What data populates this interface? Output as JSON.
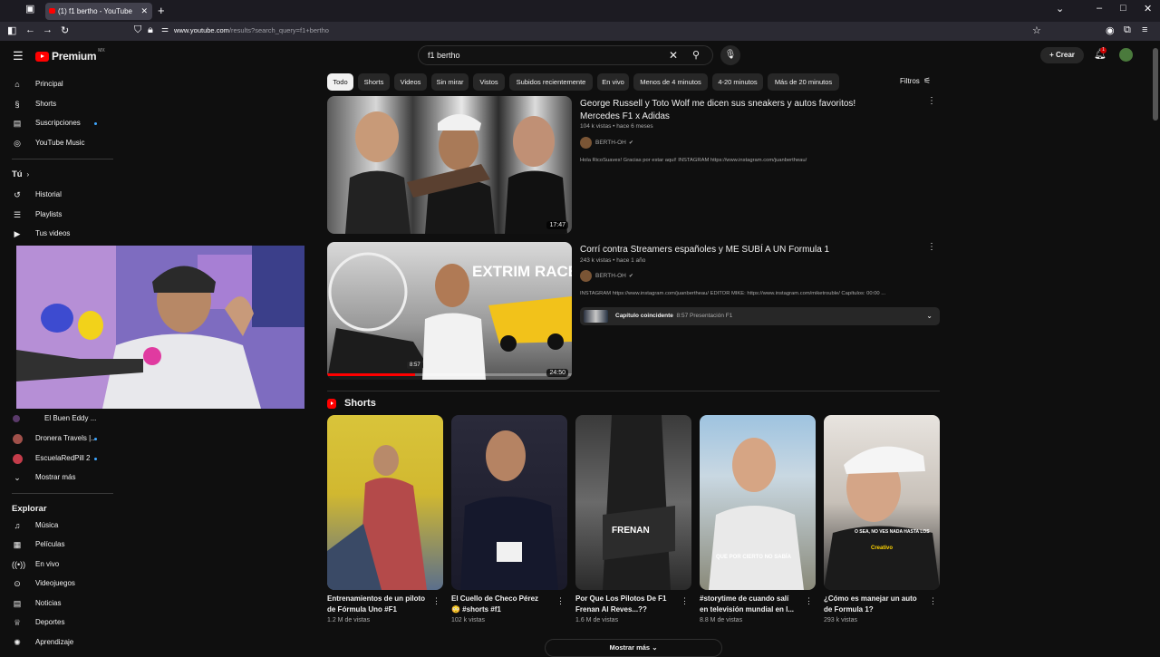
{
  "browser": {
    "tab_title": "(1) f1 bertho - YouTube",
    "url_domain": "www.youtube.com",
    "url_path": "/results?search_query=f1+bertho"
  },
  "header": {
    "logo_text": "Premium",
    "logo_region": "MX",
    "search_query": "f1 bertho",
    "create_label": "Crear",
    "notification_count": "1"
  },
  "sidebar": {
    "main": [
      {
        "label": "Principal",
        "icon": "home-icon"
      },
      {
        "label": "Shorts",
        "icon": "shorts-icon"
      },
      {
        "label": "Suscripciones",
        "icon": "subscriptions-icon"
      },
      {
        "label": "YouTube Music",
        "icon": "music-icon"
      }
    ],
    "you_heading": "Tú",
    "you": [
      {
        "label": "Historial"
      },
      {
        "label": "Playlists"
      },
      {
        "label": "Tus videos"
      }
    ],
    "subs": [
      {
        "label": "El Buen Eddy ..."
      },
      {
        "label": "Dronera Travels |..."
      },
      {
        "label": "EscuelaRedPill 2"
      }
    ],
    "show_more": "Mostrar más",
    "explore_heading": "Explorar",
    "explore": [
      {
        "label": "Música"
      },
      {
        "label": "Películas"
      },
      {
        "label": "En vivo"
      },
      {
        "label": "Videojuegos"
      },
      {
        "label": "Noticias"
      },
      {
        "label": "Deportes"
      },
      {
        "label": "Aprendizaje"
      }
    ]
  },
  "chips": [
    "Todo",
    "Shorts",
    "Videos",
    "Sin mirar",
    "Vistos",
    "Subidos recientemente",
    "En vivo",
    "Menos de 4 minutos",
    "4-20 minutos",
    "Más de 20 minutos"
  ],
  "filters_label": "Filtros",
  "videos": [
    {
      "title_line1": "George Russell y Toto Wolf me dicen sus sneakers y autos favoritos!",
      "title_line2": "Mercedes F1 x Adidas",
      "meta": "104 k vistas • hace 6 meses",
      "channel": "BERTH-OH",
      "description": "Hola RicoSuaves! Gracias por estar aquí! INSTAGRAM https://www.instagram.com/juanbertheau/",
      "duration": "17:47"
    },
    {
      "title_line1": "Corrí contra Streamers españoles y ME SUBÍ A UN Formula 1",
      "title_line2": "",
      "meta": "243 k vistas • hace 1 año",
      "channel": "BERTH-OH",
      "description": "INSTAGRAM https://www.instagram.com/juanbertheau/ EDITOR MIKE: https://www.instagram.com/miketrouble/ Capítulos: 00:00 ...",
      "duration": "24:50",
      "hover_time": "8:57",
      "thumb_text": "EXTRIM RACE",
      "watch_progress": 0.36,
      "chapter_label": "Capítulo coincidente",
      "chapter_sub": "8:57 Presentación F1"
    }
  ],
  "shorts_heading": "Shorts",
  "shorts": [
    {
      "title_line1": "Entrenamientos de un piloto",
      "title_line2": "de Fórmula Uno #F1",
      "views": "1.2 M de vistas"
    },
    {
      "title_line1": "El Cuello de Checo Pérez",
      "title_line2": "😳 #shorts #f1",
      "views": "102 k vistas"
    },
    {
      "title_line1": "Por Que Los Pilotos De F1",
      "title_line2": "Frenan Al Reves...??",
      "views": "1.6 M de vistas",
      "overlay": "FRENAN"
    },
    {
      "title_line1": "#storytime de cuando salí",
      "title_line2": "en televisión mundial en l...",
      "views": "8.8 M de vistas",
      "overlay": "QUE POR CIERTO NO SABÍA"
    },
    {
      "title_line1": "¿Cómo es manejar un auto",
      "title_line2": "de Formula 1?",
      "views": "293 k vistas",
      "overlay": "O SEA, NO VES NADA HASTA LOS",
      "overlay2": "Creativo"
    }
  ],
  "show_more_button": "Mostrar más"
}
